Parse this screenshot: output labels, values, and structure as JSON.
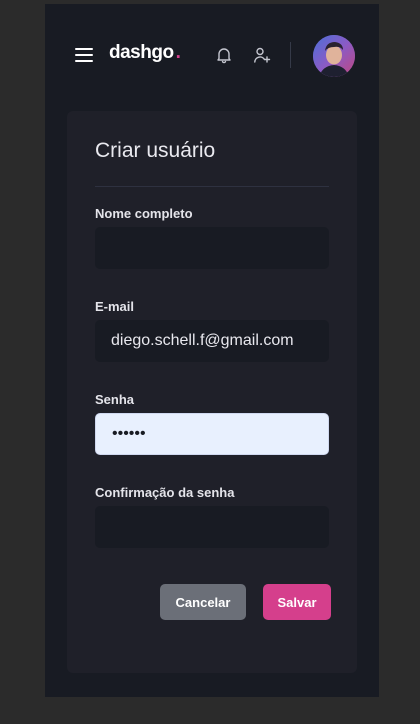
{
  "header": {
    "logo_text": "dashgo",
    "logo_dot": ".",
    "icons": [
      "menu-icon",
      "bell-icon",
      "user-add-icon"
    ]
  },
  "form": {
    "title": "Criar usuário",
    "fields": [
      {
        "label": "Nome completo",
        "value": ""
      },
      {
        "label": "E-mail",
        "value": "diego.schell.f@gmail.com"
      },
      {
        "label": "Senha",
        "value": "••••••"
      },
      {
        "label": "Confirmação da senha",
        "value": ""
      }
    ],
    "cancel_label": "Cancelar",
    "save_label": "Salvar"
  },
  "colors": {
    "background": "#181b23",
    "card": "#1f2029",
    "accent": "#d53f8c",
    "cancel_button": "#6b6f78"
  }
}
